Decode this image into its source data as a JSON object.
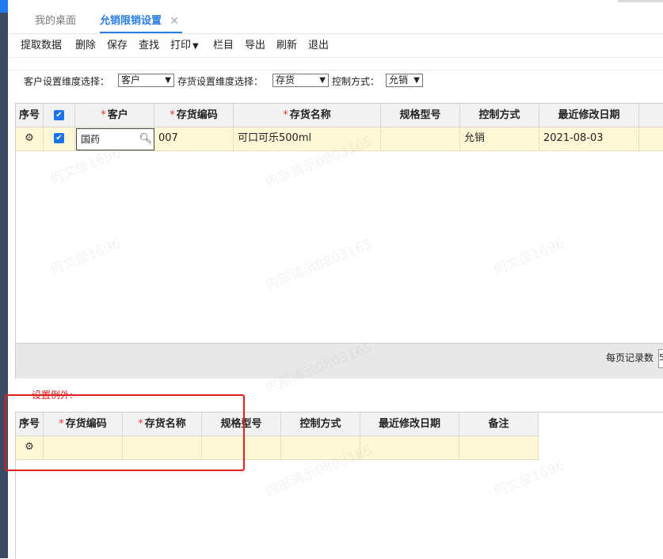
{
  "tabs": [
    {
      "label": "我的桌面",
      "active": false
    },
    {
      "label": "允销限销设置",
      "active": true
    }
  ],
  "toolbar": {
    "fetch": "提取数据",
    "delete": "删除",
    "save": "保存",
    "find": "查找",
    "print": "打印",
    "columns": "栏目",
    "export": "导出",
    "refresh": "刷新",
    "exit": "退出"
  },
  "filters": {
    "customer_dim_label": "客户设置维度选择：",
    "customer_dim_value": "客户",
    "stock_dim_label": "存货设置维度选择：",
    "stock_dim_value": "存货",
    "control_label": "控制方式：",
    "control_value": "允销"
  },
  "grid1": {
    "headers": [
      "序号",
      "客户",
      "存货编码",
      "存货名称",
      "规格型号",
      "控制方式",
      "最近修改日期"
    ],
    "rows": [
      {
        "customer": "国药",
        "code": "007",
        "name": "可口可乐500ml",
        "spec": "",
        "control": "允销",
        "date": "2021-08-03"
      }
    ],
    "pager_label": "每页记录数",
    "pager_value": "5"
  },
  "section2": {
    "label": "设置例外:",
    "headers": [
      "序号",
      "存货编码",
      "存货名称",
      "规格型号",
      "控制方式",
      "最近修改日期",
      "备注"
    ]
  },
  "icons": {
    "close": "close-icon",
    "gear": "gear-icon",
    "search": "search-icon",
    "checkbox": "checkbox-checked-icon"
  },
  "colors": {
    "accent": "#2a7de1",
    "row_highlight": "#fff8d6",
    "required": "#e33333",
    "annotation": "#e02020"
  },
  "watermark": [
    "何文俊1696",
    "内部请示0803165"
  ]
}
